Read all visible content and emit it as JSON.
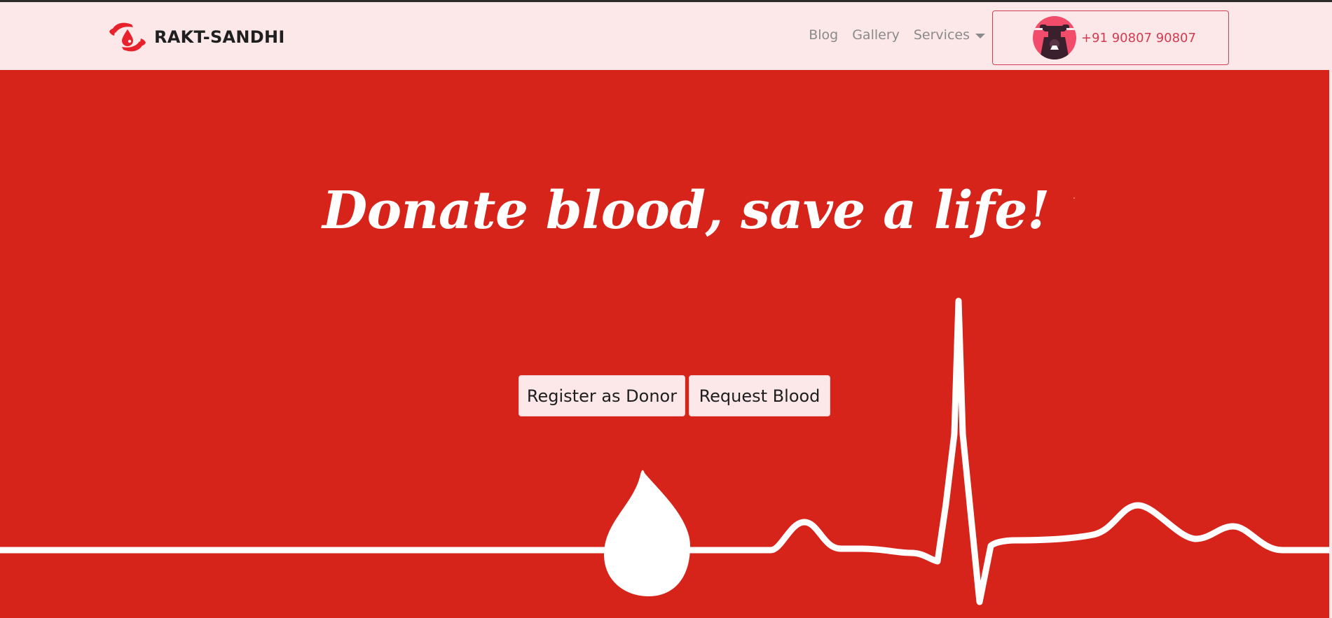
{
  "brand": {
    "name": "RAKT-SANDHI",
    "logo_icon": "hands-holding-blood-drop-icon"
  },
  "nav": {
    "items": [
      {
        "label": "Blog"
      },
      {
        "label": "Gallery"
      },
      {
        "label": "Services"
      }
    ]
  },
  "contact": {
    "phone": "+91 90807 90807",
    "icon": "telephone-icon"
  },
  "hero": {
    "headline": "Donate blood, save a life!",
    "buttons": {
      "donor_label": "Register as Donor",
      "request_label": "Request Blood"
    }
  },
  "colors": {
    "hero_red": "#d7241b",
    "nav_bg": "#fde8e9",
    "phone_accent": "#d43a4f"
  }
}
